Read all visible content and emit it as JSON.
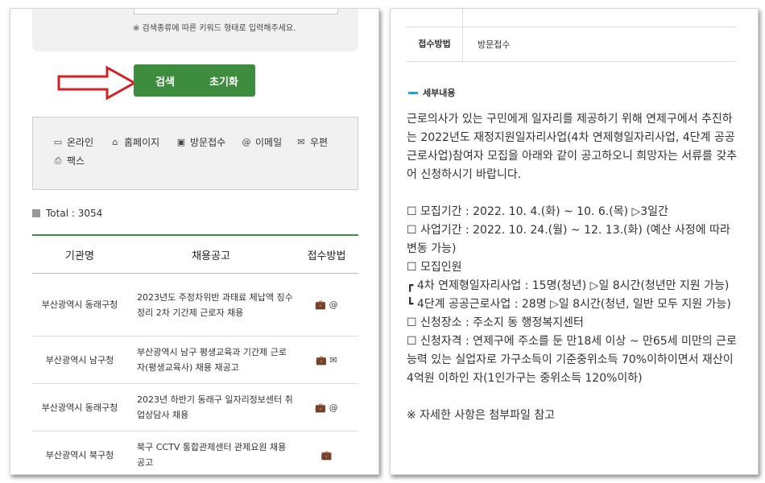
{
  "left": {
    "search_note": "※ 검색종류에 따른 키워드 형태로 입력해주세요.",
    "search_button": "검색",
    "reset_button": "초기화",
    "legend": [
      {
        "icon": "monitor-icon",
        "glyph": "🖳",
        "label": "온라인"
      },
      {
        "icon": "home-icon",
        "glyph": "⌂",
        "label": "홈페이지"
      },
      {
        "icon": "briefcase-icon",
        "glyph": "💼",
        "label": "방문접수"
      },
      {
        "icon": "at-icon",
        "glyph": "@",
        "label": "이메일"
      },
      {
        "icon": "envelope-icon",
        "glyph": "✉",
        "label": "우편"
      },
      {
        "icon": "fax-icon",
        "glyph": "⎙",
        "label": "팩스"
      }
    ],
    "total_label": "Total : 3054",
    "table": {
      "headers": [
        "기관명",
        "채용공고",
        "접수방법"
      ],
      "rows": [
        {
          "org": "부산광역시 동래구청",
          "title": "2023년도 주정차위반 과태료 체납액 징수정리 2차 기간제 근로자 채용",
          "methods": "💼 @"
        },
        {
          "org": "부산광역시 남구청",
          "title": "부산광역시 남구 평생교육과 기간제 근로자(평생교육사) 채용 재공고",
          "methods": "💼 ✉"
        },
        {
          "org": "부산광역시 동래구청",
          "title": "2023년 하반기 동래구 일자리정보센터 취업상담사 채용",
          "methods": "💼 @"
        },
        {
          "org": "부산광역시 북구청",
          "title": "북구 CCTV 통합관제센터 관제요원 채용 공고",
          "methods": "💼"
        }
      ]
    }
  },
  "right": {
    "receipt_label": "접수방법",
    "receipt_value": "방문접수",
    "section_title": "세부내용",
    "intro": "근로의사가 있는 구민에게 일자리를 제공하기 위해 연제구에서 추진하는 2022년도 재정지원일자리사업(4차 연제형일자리사업, 4단계 공공근로사업)참여자 모집을 아래와 같이 공고하오니 희망자는 서류를 갖추어 신청하시기 바랍니다.",
    "lines": [
      "☐ 모집기간 : 2022. 10. 4.(화) ~ 10. 6.(목) ▷3일간",
      "☐ 사업기간 : 2022. 10. 24.(월) ~ 12. 13.(화) (예산 사정에 따라 변동 가능)",
      "☐ 모집인원",
      "┏ 4차 연제형일자리사업 : 15명(청년) ▷일 8시간(청년만 지원 가능)",
      "┗ 4단계 공공근로사업 : 28명 ▷일 8시간(청년, 일반 모두 지원 가능)",
      "☐ 신청장소 : 주소지 동 행정복지센터",
      "☐ 신청자격 : 연제구에 주소를 둔 만18세 이상 ~ 만65세 미만의 근로능력 있는 실업자로 가구소득이 기준중위소득 70%이하이면서 재산이 4억원 이하인 자(1인가구는 중위소득 120%이하)"
    ],
    "footer_note": "※ 자세한 사항은 첨부파일 참고"
  }
}
